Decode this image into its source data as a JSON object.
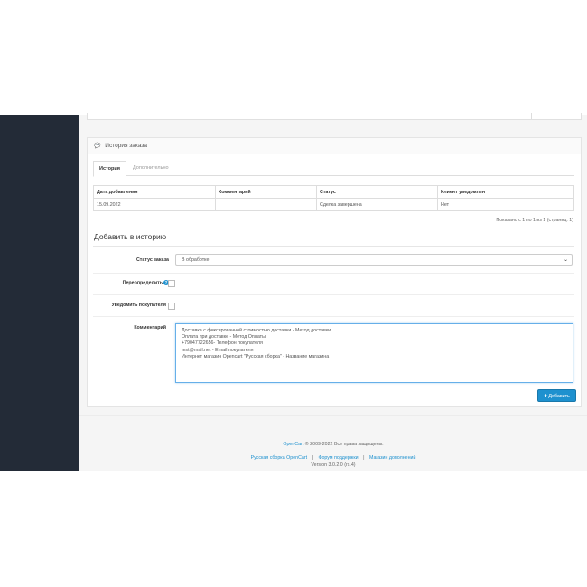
{
  "history_panel": {
    "title": "История заказа"
  },
  "tabs": [
    {
      "label": "История",
      "active": true
    },
    {
      "label": "Дополнительно",
      "active": false
    }
  ],
  "history_table": {
    "headers": [
      "Дата добавления",
      "Комментарий",
      "Статус",
      "Клиент уведомлен"
    ],
    "rows": [
      [
        "15.09.2022",
        "",
        "Сделка завершена",
        "Нет"
      ]
    ]
  },
  "pagination_text": "Показано с 1 по 1 из 1 (страниц: 1)",
  "add_history": {
    "title": "Добавить в историю",
    "order_status_label": "Статус заказа",
    "order_status_value": "В обработке",
    "override_label": "Переопределить",
    "notify_label": "Уведомить покупателя",
    "comment_label": "Комментарий",
    "comment_lines": [
      "Доставка с фиксированной стоимостью доставки - Метод доставки",
      "Оплата при доставке - Метод Оплаты",
      "+79047722656- Телефон покупателя",
      "test@mail.net - Email покупателя",
      "Интернет магазин Opencart \"Русская сборка\" - Название магазина"
    ],
    "add_button": "Добавить"
  },
  "footer": {
    "brand_link": "OpenCart",
    "copyright": "© 2009-2022 Все права защищены.",
    "links": [
      "Русская сборка OpenCart",
      "Форум поддержки",
      "Магазин дополнений"
    ],
    "separator": "|",
    "version": "Version 3.0.2.0 (rs.4)"
  },
  "colors": {
    "sidebar": "#232b37",
    "accent": "#1e91cf",
    "page_bg": "#f5f5f5"
  }
}
